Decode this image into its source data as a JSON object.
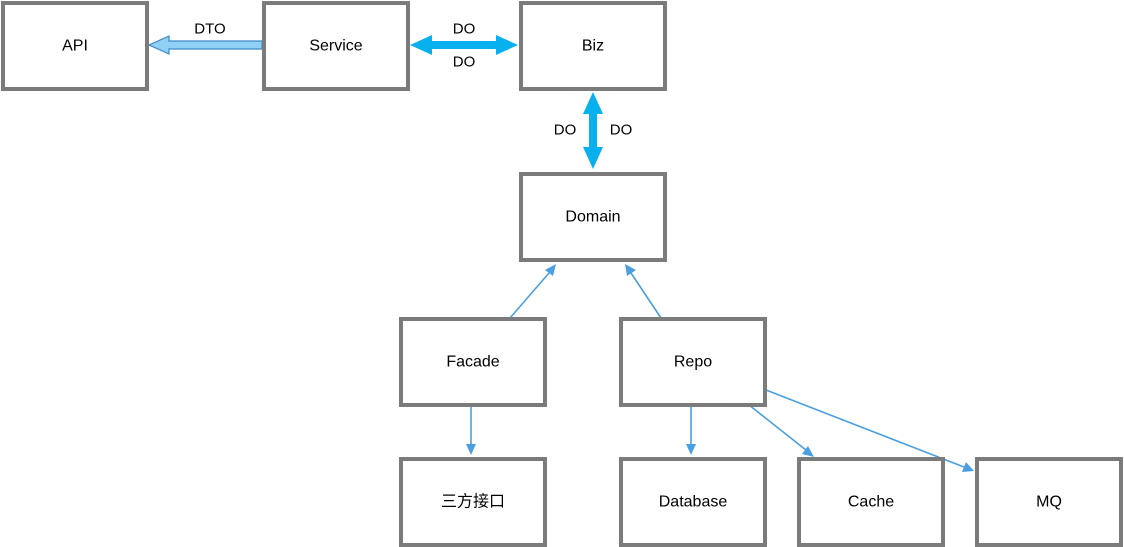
{
  "nodes": {
    "api": "API",
    "service": "Service",
    "biz": "Biz",
    "domain": "Domain",
    "facade": "Facade",
    "repo": "Repo",
    "third_party": "三方接口",
    "database": "Database",
    "cache": "Cache",
    "mq": "MQ"
  },
  "edge_labels": {
    "service_to_api": "DTO",
    "service_biz_top": "DO",
    "service_biz_bottom": "DO",
    "biz_domain_left": "DO",
    "biz_domain_right": "DO"
  },
  "colors": {
    "box_border": "#7b7b7b",
    "thin_arrow": "#4a9fe0",
    "thick_arrow": "#08b0ee",
    "block_arrow_fill": "#8fd0f5"
  }
}
